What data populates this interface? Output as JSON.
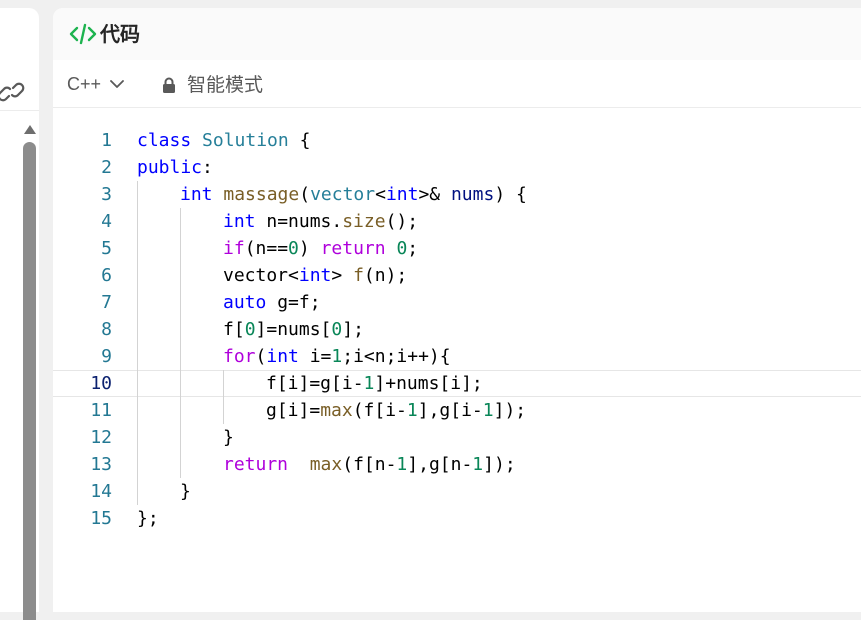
{
  "panel": {
    "title": "代码",
    "icon": "code-icon",
    "accent": "#1db34f"
  },
  "toolbar": {
    "language": "C++",
    "mode_label": "智能模式"
  },
  "editor": {
    "current_line": 10,
    "lines": [
      {
        "n": "1",
        "indent": 0,
        "tokens": [
          [
            "kw",
            "class"
          ],
          [
            "op",
            " "
          ],
          [
            "type",
            "Solution"
          ],
          [
            "op",
            " {"
          ]
        ]
      },
      {
        "n": "2",
        "indent": 0,
        "tokens": [
          [
            "kw",
            "public"
          ],
          [
            "op",
            ":"
          ]
        ]
      },
      {
        "n": "3",
        "indent": 1,
        "tokens": [
          [
            "kw",
            "int"
          ],
          [
            "op",
            " "
          ],
          [
            "fn",
            "massage"
          ],
          [
            "op",
            "("
          ],
          [
            "type",
            "vector"
          ],
          [
            "op",
            "<"
          ],
          [
            "kw",
            "int"
          ],
          [
            "op",
            "&gt;& "
          ],
          [
            "id",
            "nums"
          ],
          [
            "op",
            ") {"
          ]
        ]
      },
      {
        "n": "4",
        "indent": 2,
        "tokens": [
          [
            "kw",
            "int"
          ],
          [
            "op",
            " n=nums."
          ],
          [
            "fn",
            "size"
          ],
          [
            "op",
            "();"
          ]
        ]
      },
      {
        "n": "5",
        "indent": 2,
        "tokens": [
          [
            "ctrl",
            "if"
          ],
          [
            "op",
            "(n=="
          ],
          [
            "num",
            "0"
          ],
          [
            "op",
            ") "
          ],
          [
            "ctrl",
            "return"
          ],
          [
            "op",
            " "
          ],
          [
            "num",
            "0"
          ],
          [
            "op",
            ";"
          ]
        ]
      },
      {
        "n": "6",
        "indent": 2,
        "tokens": [
          [
            "op",
            "vector<"
          ],
          [
            "kw",
            "int"
          ],
          [
            "op",
            "> "
          ],
          [
            "fn",
            "f"
          ],
          [
            "op",
            "(n);"
          ]
        ]
      },
      {
        "n": "7",
        "indent": 2,
        "tokens": [
          [
            "kw",
            "auto"
          ],
          [
            "op",
            " g=f;"
          ]
        ]
      },
      {
        "n": "8",
        "indent": 2,
        "tokens": [
          [
            "op",
            "f["
          ],
          [
            "num",
            "0"
          ],
          [
            "op",
            "]=nums["
          ],
          [
            "num",
            "0"
          ],
          [
            "op",
            "];"
          ]
        ]
      },
      {
        "n": "9",
        "indent": 2,
        "tokens": [
          [
            "ctrl",
            "for"
          ],
          [
            "op",
            "("
          ],
          [
            "kw",
            "int"
          ],
          [
            "op",
            " i="
          ],
          [
            "num",
            "1"
          ],
          [
            "op",
            ";i<n;i++){"
          ]
        ]
      },
      {
        "n": "10",
        "indent": 3,
        "tokens": [
          [
            "op",
            "f[i]=g[i-"
          ],
          [
            "num",
            "1"
          ],
          [
            "op",
            "]+nums[i];"
          ]
        ]
      },
      {
        "n": "11",
        "indent": 3,
        "tokens": [
          [
            "op",
            "g[i]="
          ],
          [
            "fn",
            "max"
          ],
          [
            "op",
            "(f[i-"
          ],
          [
            "num",
            "1"
          ],
          [
            "op",
            "],g[i-"
          ],
          [
            "num",
            "1"
          ],
          [
            "op",
            "]);"
          ]
        ]
      },
      {
        "n": "12",
        "indent": 2,
        "tokens": [
          [
            "op",
            "}"
          ]
        ]
      },
      {
        "n": "13",
        "indent": 2,
        "tokens": [
          [
            "ctrl",
            "return"
          ],
          [
            "op",
            "  "
          ],
          [
            "fn",
            "max"
          ],
          [
            "op",
            "(f[n-"
          ],
          [
            "num",
            "1"
          ],
          [
            "op",
            "],g[n-"
          ],
          [
            "num",
            "1"
          ],
          [
            "op",
            "]);"
          ]
        ]
      },
      {
        "n": "14",
        "indent": 1,
        "tokens": [
          [
            "op",
            "}"
          ]
        ]
      },
      {
        "n": "15",
        "indent": 0,
        "tokens": [
          [
            "op",
            "};"
          ]
        ]
      }
    ]
  }
}
